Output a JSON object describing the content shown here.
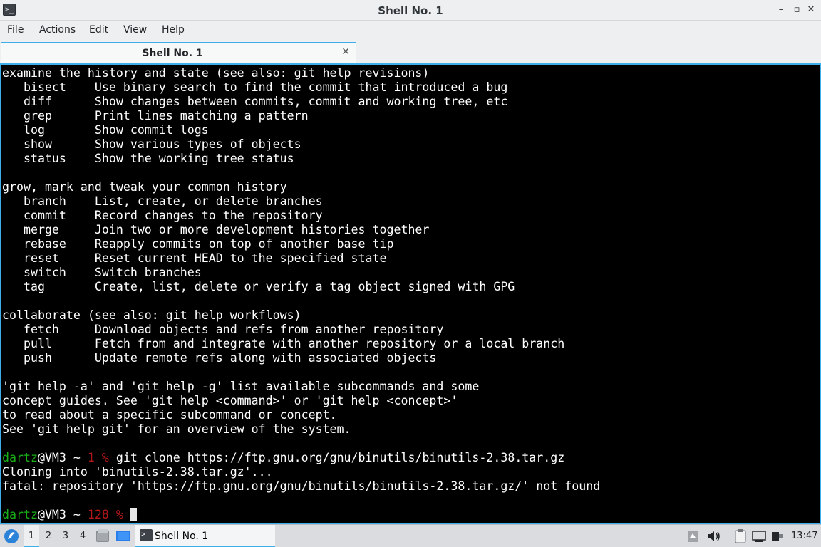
{
  "window": {
    "title": "Shell No. 1",
    "buttons": {
      "minimize": "–",
      "maximize": "▫",
      "close": "✕"
    }
  },
  "menubar": {
    "items": [
      {
        "label": "File"
      },
      {
        "label": "Actions"
      },
      {
        "label": "Edit"
      },
      {
        "label": "View"
      },
      {
        "label": "Help"
      }
    ]
  },
  "tabs": [
    {
      "label": "Shell No. 1",
      "close": "✕"
    }
  ],
  "terminal": {
    "lines": [
      "examine the history and state (see also: git help revisions)",
      "   bisect    Use binary search to find the commit that introduced a bug",
      "   diff      Show changes between commits, commit and working tree, etc",
      "   grep      Print lines matching a pattern",
      "   log       Show commit logs",
      "   show      Show various types of objects",
      "   status    Show the working tree status",
      "",
      "grow, mark and tweak your common history",
      "   branch    List, create, or delete branches",
      "   commit    Record changes to the repository",
      "   merge     Join two or more development histories together",
      "   rebase    Reapply commits on top of another base tip",
      "   reset     Reset current HEAD to the specified state",
      "   switch    Switch branches",
      "   tag       Create, list, delete or verify a tag object signed with GPG",
      "",
      "collaborate (see also: git help workflows)",
      "   fetch     Download objects and refs from another repository",
      "   pull      Fetch from and integrate with another repository or a local branch",
      "   push      Update remote refs along with associated objects",
      "",
      "'git help -a' and 'git help -g' list available subcommands and some",
      "concept guides. See 'git help <command>' or 'git help <concept>'",
      "to read about a specific subcommand or concept.",
      "See 'git help git' for an overview of the system.",
      ""
    ],
    "prompt1": {
      "user": "dartz",
      "host": "@VM3 ~ ",
      "status": "1 %",
      "command": " git clone https://ftp.gnu.org/gnu/binutils/binutils-2.38.tar.gz"
    },
    "output_lines": [
      "Cloning into 'binutils-2.38.tar.gz'...",
      "fatal: repository 'https://ftp.gnu.org/gnu/binutils/binutils-2.38.tar.gz/' not found",
      ""
    ],
    "prompt2": {
      "user": "dartz",
      "host": "@VM3 ~ ",
      "status": "128 %"
    },
    "colors": {
      "background": "#000000",
      "user": "#18b218",
      "error_status": "#b21818",
      "text": "#ffffff"
    }
  },
  "taskbar": {
    "desktops": [
      "1",
      "2",
      "3",
      "4"
    ],
    "active_desktop": "1",
    "task": {
      "label": "Shell No. 1"
    },
    "clock": "13:47",
    "icons": [
      "start-menu-icon",
      "file-manager-icon",
      "show-desktop-icon",
      "terminal-icon",
      "notifications-icon",
      "volume-icon",
      "clipboard-icon",
      "network-icon",
      "power-icon"
    ]
  },
  "accent": "#3daee9"
}
